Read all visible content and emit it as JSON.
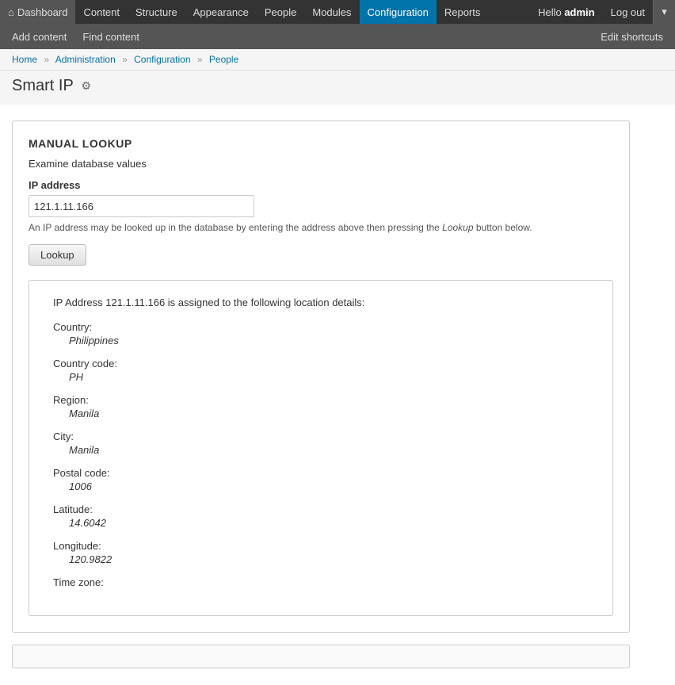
{
  "topnav": {
    "home_label": "⌂",
    "items": [
      {
        "label": "Dashboard",
        "name": "dashboard",
        "active": false
      },
      {
        "label": "Content",
        "name": "content",
        "active": false
      },
      {
        "label": "Structure",
        "name": "structure",
        "active": false
      },
      {
        "label": "Appearance",
        "name": "appearance",
        "active": false
      },
      {
        "label": "People",
        "name": "people",
        "active": false
      },
      {
        "label": "Modules",
        "name": "modules",
        "active": false
      },
      {
        "label": "Configuration",
        "name": "configuration",
        "active": true
      },
      {
        "label": "Reports",
        "name": "reports",
        "active": false
      }
    ],
    "hello_text": "Hello",
    "admin_name": "admin",
    "logout_label": "Log out",
    "dropdown_arrow": "▾"
  },
  "secondarynav": {
    "items": [
      {
        "label": "Add content",
        "name": "add-content"
      },
      {
        "label": "Find content",
        "name": "find-content"
      }
    ],
    "edit_shortcuts_label": "Edit shortcuts"
  },
  "breadcrumb": {
    "items": [
      {
        "label": "Home",
        "name": "home"
      },
      {
        "label": "Administration",
        "name": "administration"
      },
      {
        "label": "Configuration",
        "name": "configuration"
      },
      {
        "label": "People",
        "name": "people"
      }
    ],
    "separator": "»"
  },
  "page_title": "Smart IP",
  "gear_icon": "⚙",
  "manual_lookup": {
    "heading": "MANUAL LOOKUP",
    "description": "Examine database values",
    "ip_label": "IP address",
    "ip_value": "121.1.11.166",
    "ip_placeholder": "",
    "help_text_before": "An IP address may be looked up in the database by entering the address above then pressing the",
    "help_text_keyword": "Lookup",
    "help_text_after": "button below.",
    "lookup_button": "Lookup"
  },
  "results": {
    "header": "IP Address 121.1.11.166 is assigned to the following location details:",
    "fields": [
      {
        "name": "Country:",
        "value": "Philippines"
      },
      {
        "name": "Country code:",
        "value": "PH"
      },
      {
        "name": "Region:",
        "value": "Manila"
      },
      {
        "name": "City:",
        "value": "Manila"
      },
      {
        "name": "Postal code:",
        "value": "1006"
      },
      {
        "name": "Latitude:",
        "value": "14.6042"
      },
      {
        "name": "Longitude:",
        "value": "120.9822"
      },
      {
        "name": "Time zone:",
        "value": ""
      }
    ]
  }
}
